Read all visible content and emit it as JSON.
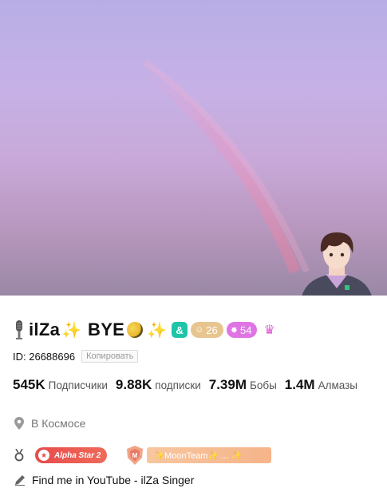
{
  "profile": {
    "display_name": "ilZa",
    "name_suffix": "BYE",
    "icons": [
      "microphone-icon",
      "sparkles-icon",
      "moon-icon",
      "sparkles-icon",
      "friend-badge-icon",
      "crown-icon"
    ],
    "level_badge": "26",
    "star_badge": "54",
    "id_text": "ID: 26688696",
    "copy_label": "Копировать"
  },
  "stats": [
    {
      "value": "545K",
      "label": "Подписчики"
    },
    {
      "value": "9.88K",
      "label": "подписки"
    },
    {
      "value": "7.39M",
      "label": "Бобы"
    },
    {
      "value": "1.4M",
      "label": "Алмазы"
    }
  ],
  "location": "В Космосе",
  "medals": {
    "alpha_star": "Alpha Star 2",
    "team_name": "✨MoonTeam✨ ... ✨"
  },
  "bio": "Find me in YouTube - ilZa Singer",
  "colors": {
    "level_badge": "#e8c58f",
    "star_badge": "#df74e5",
    "friend_badge": "#1fc5a8",
    "crown": "#e05bd3",
    "alpha_badge": "#e64b4b",
    "team_badge": "#f6b489"
  }
}
